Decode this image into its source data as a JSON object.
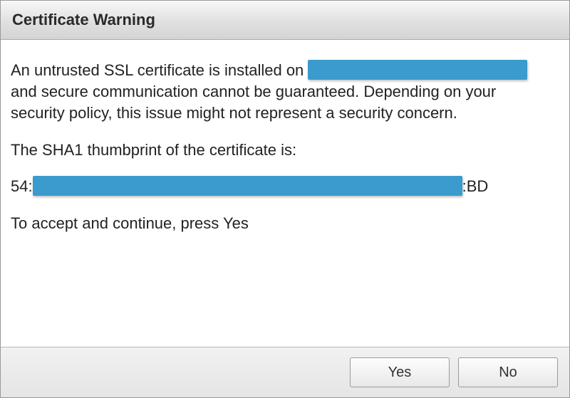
{
  "title": "Certificate Warning",
  "body": {
    "line1_prefix": "An untrusted SSL certificate is installed on ",
    "line2": "and secure communication cannot be guaranteed. Depending on your",
    "line3": "security policy, this issue might not represent a security concern.",
    "thumb_intro": "The SHA1 thumbprint of the certificate is:",
    "thumb_prefix": "54:",
    "thumb_suffix": ":BD",
    "accept_text": "To accept and continue, press Yes"
  },
  "buttons": {
    "yes": "Yes",
    "no": "No"
  }
}
